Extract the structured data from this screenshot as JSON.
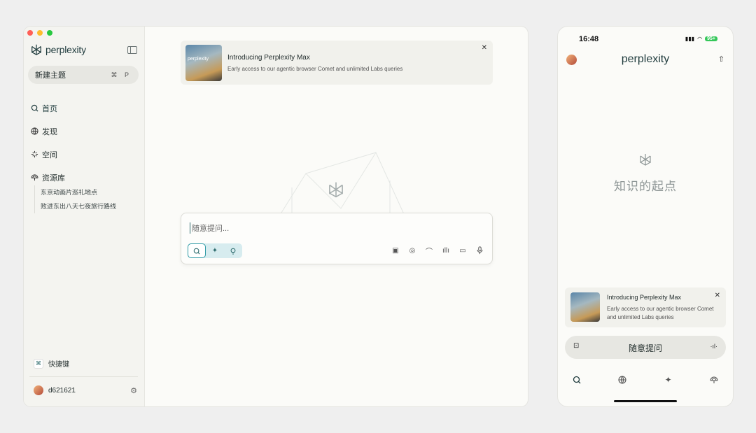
{
  "desktop": {
    "sidebar": {
      "brand": "perplexity",
      "new_thread": {
        "label": "新建主题",
        "shortcut": "⌘ P"
      },
      "nav": [
        {
          "label": "首页",
          "icon": "search-icon"
        },
        {
          "label": "发现",
          "icon": "globe-icon"
        },
        {
          "label": "空间",
          "icon": "spaces-icon"
        },
        {
          "label": "资源库",
          "icon": "library-icon"
        }
      ],
      "library_items": [
        "东京动画片巡礼地点",
        "败进东出八天七夜旅行路线"
      ],
      "shortcuts_label": "快捷键",
      "username": "d621621"
    },
    "banner": {
      "title": "Introducing Perplexity Max",
      "subtitle": "Early access to our agentic browser Comet and unlimited Labs queries",
      "thumb_text": "perplexity"
    },
    "input": {
      "placeholder": "随意提问..."
    }
  },
  "phone": {
    "time": "16:48",
    "battery": "95+",
    "brand": "perplexity",
    "tagline": "知识的起点",
    "banner": {
      "title": "Introducing Perplexity Max",
      "subtitle": "Early access to our agentic browser Comet and unlimited Labs queries"
    },
    "input_label": "随意提问"
  }
}
